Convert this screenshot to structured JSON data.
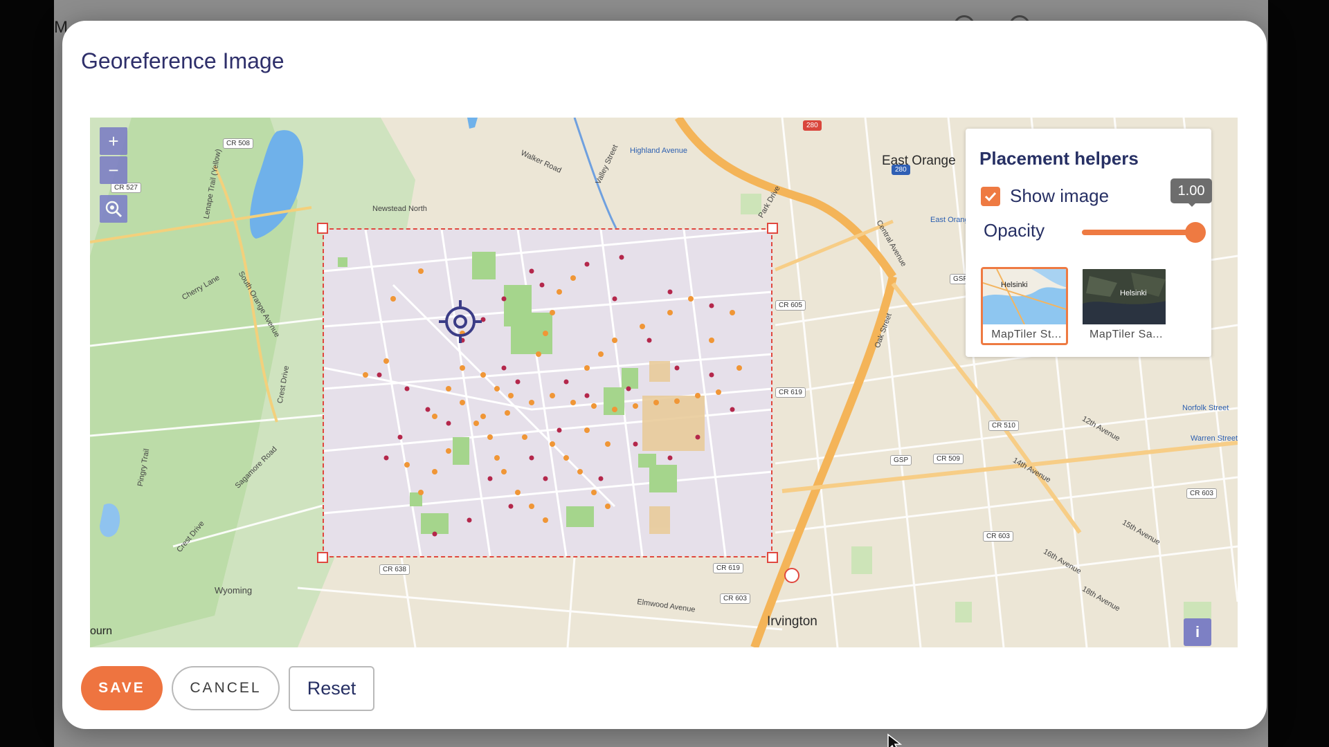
{
  "backdrop": {
    "menu_text": "M"
  },
  "modal": {
    "title": "Georeference Image"
  },
  "map": {
    "cities": [
      "East Orange",
      "Irvington",
      "Wyoming",
      "ourn"
    ],
    "places": [
      "Highland Avenue",
      "East Orange",
      "Norfolk Street",
      "Warren Street"
    ],
    "roads": [
      "CR 508",
      "CR 527",
      "CR 605",
      "CR 619",
      "CR 510",
      "CR 509",
      "CR 638",
      "CR 619",
      "CR 603",
      "CR 603",
      "CR 603",
      "GSP",
      "GSP"
    ],
    "streets": [
      "Walker Road",
      "Valley Street",
      "Newstead North",
      "Cherry Lane",
      "South Orange Avenue",
      "Lenape Trail (Yellow)",
      "Crest Drive",
      "Sagamore Road",
      "Pingry Trail",
      "Crest Drive",
      "Elmwood Avenue",
      "12th Avenue",
      "14th Avenue",
      "15th Avenue",
      "16th Avenue",
      "18th Avenue",
      "Park Drive",
      "Central Avenue",
      "Oak Street"
    ],
    "highways": [
      "280",
      "280"
    ]
  },
  "zoom": {
    "in": "+",
    "out": "−"
  },
  "helpers": {
    "title": "Placement helpers",
    "show_image_label": "Show image",
    "show_image_checked": true,
    "opacity_label": "Opacity",
    "opacity_value": "1.00",
    "opacity_fraction": 1.0,
    "layers": [
      {
        "caption": "MapTiler St...",
        "thumb_label": "Helsinki",
        "selected": true
      },
      {
        "caption": "MapTiler Sa...",
        "thumb_label": "Helsinki",
        "selected": false
      }
    ]
  },
  "info_button": "i",
  "buttons": {
    "save": "SAVE",
    "cancel": "CANCEL",
    "reset": "Reset"
  },
  "colors": {
    "accent": "#ee7440",
    "title": "#273064",
    "frame": "#e0473e",
    "control": "#7d80c4"
  }
}
